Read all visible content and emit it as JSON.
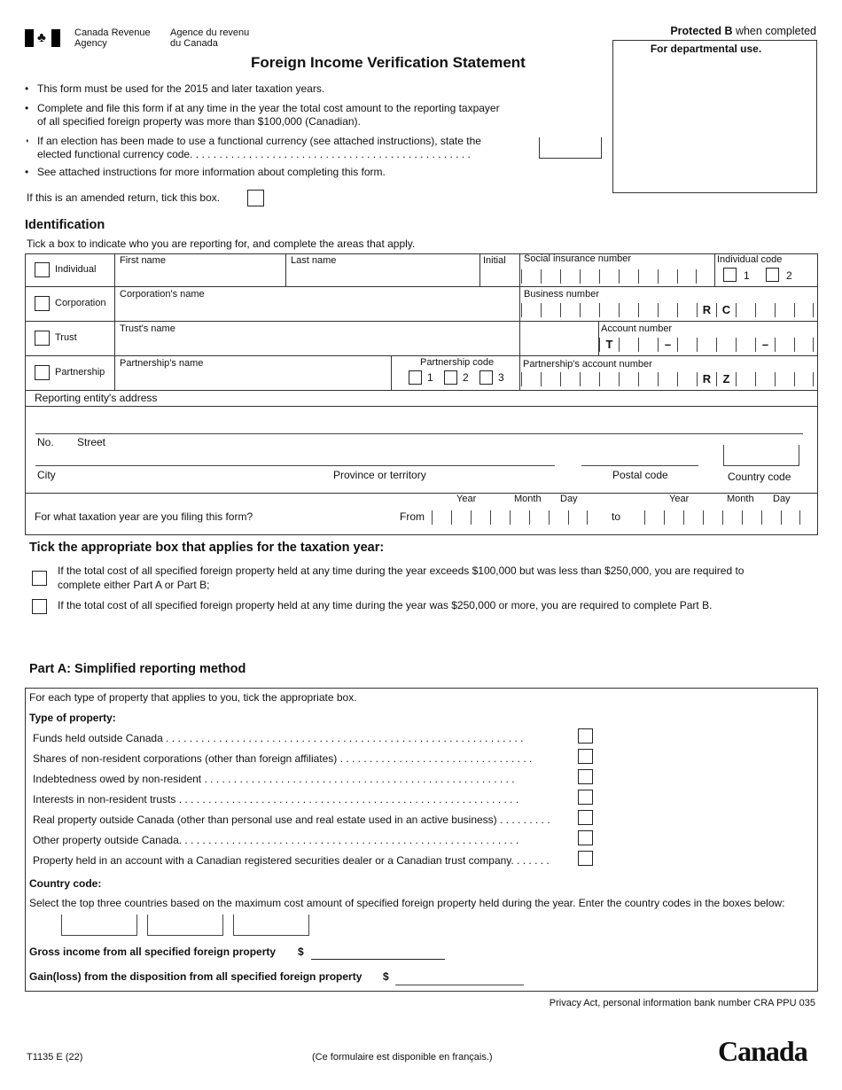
{
  "header": {
    "agency_en_1": "Canada Revenue",
    "agency_en_2": "Agency",
    "agency_fr_1": "Agence du revenu",
    "agency_fr_2": "du Canada",
    "protected": "Protected B",
    "protected_suffix": " when completed",
    "departmental": "For departmental use.",
    "title": "Foreign Income Verification Statement"
  },
  "intro": {
    "bullets": [
      "This form must be used for the 2015 and later taxation years.",
      "Complete and file this form if at any time in the year the total cost amount to the reporting taxpayer",
      "of all specified foreign property was more than $100,000 (Canadian).",
      "If an election has been made to use a functional currency (see attached instructions), state the",
      "elected functional currency code. . . . . . . . . . . . . . . . . . . . . . . . . . . . . . . . . . . . . . . . . . . . . . . .",
      "See attached instructions for more information about completing this form."
    ],
    "amended": "If this is an amended return, tick this box."
  },
  "identification": {
    "heading": "Identification",
    "instruction": "Tick a box to indicate who you are reporting for, and complete the areas that apply.",
    "individual": "Individual",
    "first_name": "First name",
    "last_name": "Last name",
    "initial": "Initial",
    "sin": "Social insurance number",
    "individual_code": "Individual code",
    "code1": "1",
    "code2": "2",
    "code3": "3",
    "corporation": "Corporation",
    "corp_name": "Corporation's name",
    "business_number": "Business number",
    "rc": [
      "R",
      "C"
    ],
    "trust": "Trust",
    "trust_name": "Trust's name",
    "account_number": "Account number",
    "t": "T",
    "dash": "–",
    "partnership": "Partnership",
    "partnership_name": "Partnership's name",
    "partnership_code": "Partnership code",
    "partnership_account": "Partnership's account number",
    "rz": [
      "R",
      "Z"
    ],
    "address": "Reporting entity's address",
    "no": "No.",
    "street": "Street",
    "city": "City",
    "province": "Province or territory",
    "postal": "Postal code",
    "country": "Country code",
    "tax_year_q": "For what taxation year are you filing this form?",
    "from": "From",
    "to": "to",
    "year": "Year",
    "month": "Month",
    "day": "Day"
  },
  "tick": {
    "heading": "Tick the appropriate box that applies for the taxation year:",
    "opt1a": "If the total cost of all specified foreign property held at any time during the year exceeds $100,000 but was less than $250,000, you are required to",
    "opt1b": "complete either Part A or Part B;",
    "opt2": "If the total cost of all specified foreign property held at any time during the year was  $250,000 or more, you are required to complete Part B."
  },
  "partA": {
    "heading": "Part A: Simplified reporting method",
    "instruction": "For each type of property that applies to you, tick the appropriate box.",
    "type_label": "Type of property:",
    "properties": [
      "Funds held outside Canada . . . . . . . . . . . . . . . . . . . . . . . . . . . . . . . . . . . . . . . . . . . . . . . . . . . . . . . . . . . . .",
      "Shares of non-resident corporations (other than foreign affiliates) . . . . . . . . . . . . . . . . . . . . . . . . . . . . . . . . .",
      "Indebtedness owed by non-resident  . . . . . . . . . . . . . . . . . . . . . . . . . . . . . . . . . . . . . . . . . . . . . . . . . . . . .",
      "Interests in non-resident trusts  . . . . . . . . . . . . . . . . . . . . . . . . . . . . . . . . . . . . . . . . . . . . . . . . . . . . . . . . . .",
      "Real property outside Canada (other than personal use and real estate used in an active business) . . . . . . . . .",
      "Other property outside Canada. . . . . . . . . . . . . . . . . . . . . . . . . . . . . . . . . . . . . . . . . . . . . . . . . . . . . . . . . .",
      "Property held in an account with a Canadian registered securities dealer or a Canadian trust company. . . . . . ."
    ],
    "country_label": "Country code:",
    "country_instruction": "Select the top three countries based on the maximum cost amount of specified foreign property held during the year. Enter the country codes in the boxes below:",
    "gross": "Gross income from all specified foreign property",
    "gain": "Gain(loss) from the disposition from all specified foreign property",
    "dollar": "$"
  },
  "footer": {
    "privacy": "Privacy Act, personal information bank number CRA PPU 035",
    "form_id": "T1135 E (22)",
    "french": "(Ce formulaire est disponible en français.)",
    "wordmark": "Canada"
  }
}
